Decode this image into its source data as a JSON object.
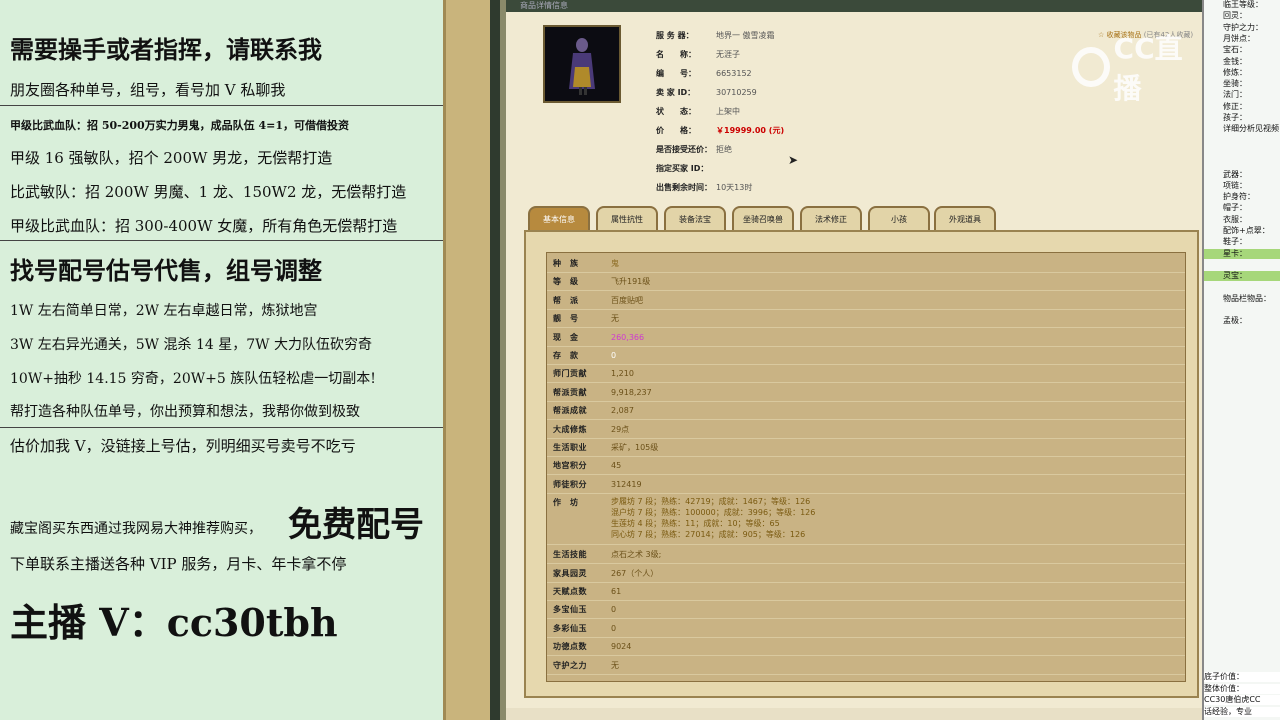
{
  "left_ad": {
    "line1": "需要操手或者指挥，请联系我",
    "line2": "朋友圈各种单号，组号，看号加 V 私聊我",
    "line3": "甲级比武血队：招 50-200万实力男鬼，成品队伍 4=1，可借借投资",
    "line4": "甲级 16 强敏队，招个 200W 男龙，无偿帮打造",
    "line5": "比武敏队：招 200W 男魔、1 龙、150W2 龙，无偿帮打造",
    "line6": "甲级比武血队：招 300-400W 女魔，所有角色无偿帮打造",
    "line7": "找号配号估号代售，组号调整",
    "line8": "1W 左右简单日常，2W 左右卓越日常，炼狱地宫",
    "line9": "3W 左右异光通关，5W 混杀 14 星，7W 大力队伍砍穷奇",
    "line10": "10W+抽秒 14.15 穷奇，20W+5 族队伍轻松虐一切副本!",
    "line11": "帮打造各种队伍单号，你出预算和想法，我帮你做到极致",
    "line12": "估价加我 V，没链接上号估，列明细买号卖号不吃亏",
    "line13a": "藏宝阁买东西通过我网易大神推荐购买，",
    "line13b": "免费配号",
    "line14": "下单联系主播送各种 VIP 服务，月卡、年卡拿不停",
    "line15": "主播 V：cc30tbh"
  },
  "game": {
    "window_title": "商品详情信息",
    "info": [
      {
        "label": "服 务 器：",
        "value": "地界一 傲雪凌霜"
      },
      {
        "label": "名　　称：",
        "value": "无涯子"
      },
      {
        "label": "编　　号：",
        "value": "6653152"
      },
      {
        "label": "卖 家 ID：",
        "value": "30710259"
      },
      {
        "label": "状　　态：",
        "value": "上架中"
      },
      {
        "label": "价　　格：",
        "value": "￥19999.00 (元)"
      },
      {
        "label": "是否接受还价：",
        "value": "拒绝"
      },
      {
        "label": "指定买家 ID：",
        "value": ""
      },
      {
        "label": "出售剩余时间：",
        "value": "10天13时"
      }
    ],
    "favorite": {
      "label": "收藏该物品",
      "count": "(已有42人收藏)"
    },
    "logo_text": "CC直播",
    "tabs": [
      "基本信息",
      "属性抗性",
      "装备法宝",
      "坐骑召唤兽",
      "法术修正",
      "小孩",
      "外观道具"
    ],
    "rows": [
      {
        "k": "种　族",
        "v": "鬼"
      },
      {
        "k": "等　级",
        "v": "飞升191级"
      },
      {
        "k": "帮　派",
        "v": "百度贴吧"
      },
      {
        "k": "靓　号",
        "v": "无"
      },
      {
        "k": "现　金",
        "v": "260,366"
      },
      {
        "k": "存　款",
        "v": "0"
      },
      {
        "k": "师门贡献",
        "v": "1,210"
      },
      {
        "k": "帮派贡献",
        "v": "9,918,237"
      },
      {
        "k": "帮派成就",
        "v": "2,087"
      },
      {
        "k": "大成修炼",
        "v": "29点"
      },
      {
        "k": "生活职业",
        "v": "采矿，105级"
      },
      {
        "k": "地宫积分",
        "v": "45"
      },
      {
        "k": "师徒积分",
        "v": "312419"
      }
    ],
    "workshop_key": "作　坊",
    "workshop": [
      "步履坊 7 段；熟练：42719；成就：1467；等级：126",
      "混户坊 7 段；熟练：100000；成就：3996；等级：126",
      "生莲坊 4 段；熟练：11；成就：10；等级：65",
      "同心坊 7 段；熟练：27014；成就：905；等级：126"
    ],
    "rows2": [
      {
        "k": "生活技能",
        "v": "点石之术 3级;"
      },
      {
        "k": "家具园灵",
        "v": "267（个人）"
      },
      {
        "k": "天赋点数",
        "v": "61"
      },
      {
        "k": "多宝仙玉",
        "v": "0"
      },
      {
        "k": "多彩仙玉",
        "v": "0"
      },
      {
        "k": "功德点数",
        "v": "9024"
      },
      {
        "k": "守护之力",
        "v": "无"
      }
    ]
  },
  "sidebar": {
    "lines": [
      {
        "n": "",
        "t": "临王等级："
      },
      {
        "n": "",
        "t": "回灵："
      },
      {
        "n": "",
        "t": "守护之力："
      },
      {
        "n": "",
        "t": "月饼点："
      },
      {
        "n": "",
        "t": "宝石："
      },
      {
        "n": "",
        "t": "金钱："
      },
      {
        "n": "",
        "t": "修炼："
      },
      {
        "n": "",
        "t": "坐骑："
      },
      {
        "n": "",
        "t": "法门："
      },
      {
        "n": "",
        "t": "修正："
      },
      {
        "n": "",
        "t": "孩子："
      },
      {
        "n": "",
        "t": "详细分析见视频"
      },
      {
        "n": "",
        "t": ""
      },
      {
        "n": "",
        "t": ""
      },
      {
        "n": "",
        "t": ""
      },
      {
        "n": "",
        "t": "武器："
      },
      {
        "n": "",
        "t": "项链："
      },
      {
        "n": "",
        "t": "护身符："
      },
      {
        "n": "",
        "t": "帽子："
      },
      {
        "n": "",
        "t": "衣服："
      },
      {
        "n": "",
        "t": "配饰+点翠："
      },
      {
        "n": "",
        "t": "鞋子："
      },
      {
        "n": "",
        "t": "星卡："
      },
      {
        "n": "",
        "t": ""
      },
      {
        "n": "",
        "t": "灵宝："
      },
      {
        "n": "",
        "t": ""
      },
      {
        "n": "",
        "t": "物品栏物品："
      },
      {
        "n": "",
        "t": ""
      },
      {
        "n": "",
        "t": "孟极："
      }
    ],
    "bottom": [
      "底子价值：",
      "整体价值：",
      "CC30唐伯虎CC",
      "话经验，专业"
    ]
  }
}
